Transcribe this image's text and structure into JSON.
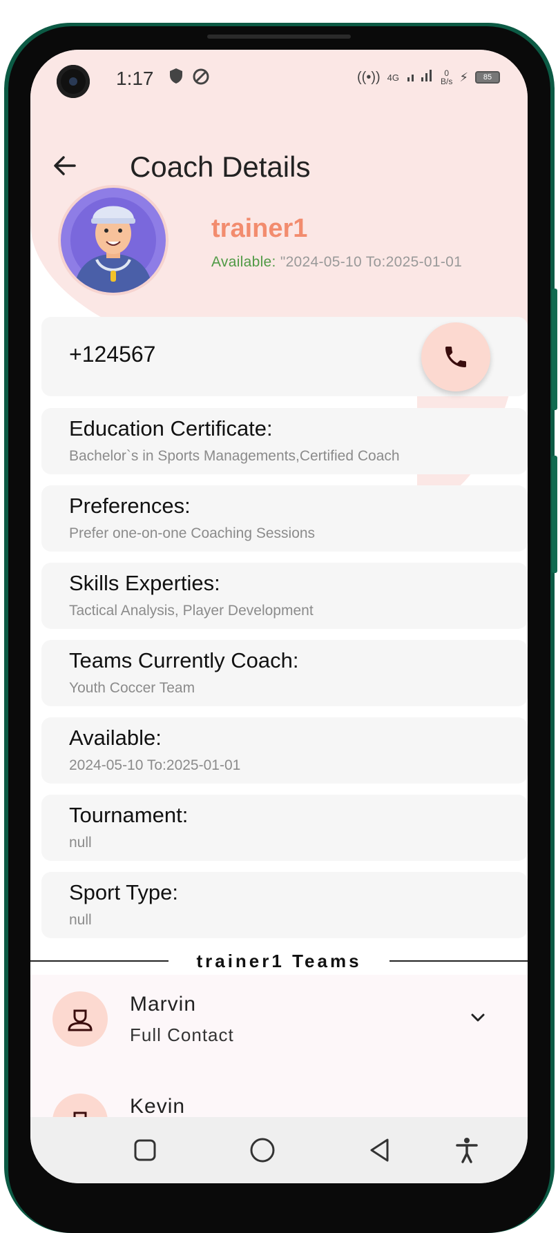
{
  "status_bar": {
    "time": "1:17",
    "battery": "85",
    "net_speed_value": "0",
    "net_speed_unit": "B/s",
    "network": "4G"
  },
  "app_bar": {
    "title": "Coach Details",
    "back_icon": "arrow-left-icon"
  },
  "profile": {
    "name": "trainer1",
    "available_label": "Available:",
    "available_value": " \"2024-05-10 To:2025-01-01"
  },
  "phone": {
    "number": "+124567",
    "call_icon": "phone-icon"
  },
  "details": [
    {
      "label": "Education Certificate:",
      "value": "Bachelor`s in Sports Managements,Certified Coach"
    },
    {
      "label": "Preferences:",
      "value": "Prefer one-on-one Coaching Sessions"
    },
    {
      "label": "Skills Experties:",
      "value": "Tactical Analysis, Player Development"
    },
    {
      "label": "Teams Currently Coach:",
      "value": "Youth Coccer Team"
    },
    {
      "label": "Available:",
      "value": "2024-05-10 To:2025-01-01"
    },
    {
      "label": "Tournament:",
      "value": "null"
    },
    {
      "label": "Sport Type:",
      "value": "null"
    }
  ],
  "teams_section": {
    "heading": "trainer1 Teams",
    "teams": [
      {
        "name": "Marvin",
        "type": "Full Contact"
      },
      {
        "name": "Kevin",
        "type": ""
      }
    ]
  },
  "colors": {
    "header_bg": "#fbe7e5",
    "accent": "#f28c6e",
    "available_green": "#4f9a45",
    "card_bg": "#f6f6f6",
    "phone_frame": "#0c5a44"
  }
}
